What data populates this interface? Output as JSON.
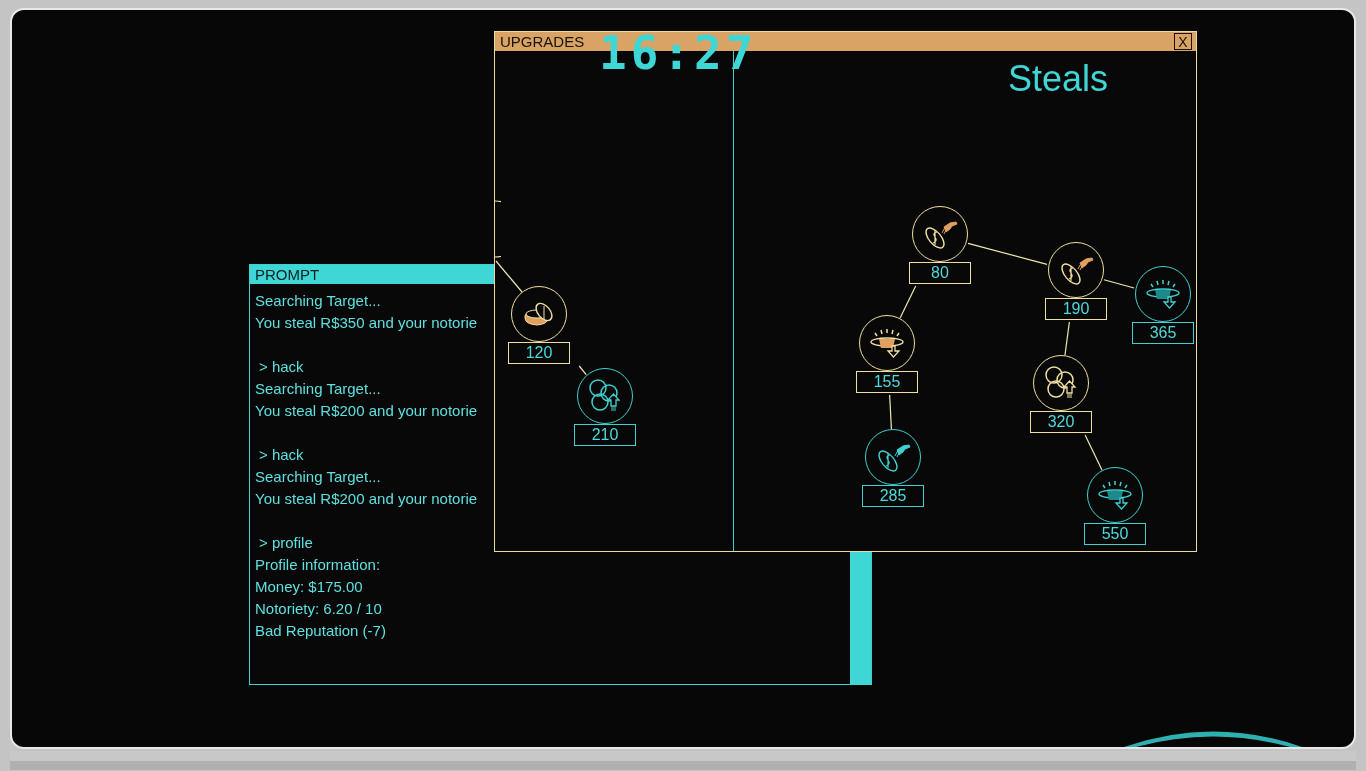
{
  "prompt_window": {
    "title": "PROMPT",
    "blocks": [
      {
        "lines": [
          "Searching Target...",
          "You steal R$350 and your notorie"
        ]
      },
      {
        "command": "> hack",
        "lines": [
          "Searching Target...",
          "You steal R$200 and your notorie"
        ]
      },
      {
        "command": "> hack",
        "lines": [
          "Searching Target...",
          "You steal R$200 and your notorie"
        ]
      },
      {
        "command": "> profile",
        "lines": [
          "Profile information:",
          "Money: $175.00",
          "Notoriety: 6.20 / 10",
          "Bad Reputation (-7)"
        ]
      }
    ]
  },
  "upgrades_window": {
    "title": "UPGRADES",
    "close_label": "X",
    "timer": "16:27",
    "left_tree": [
      {
        "cost": "120",
        "kind": "coins",
        "purchased": true,
        "children": [
          {
            "cost": "210",
            "kind": "bubbles",
            "purchased": false
          }
        ]
      }
    ],
    "right_panel": {
      "title": "Steals",
      "tree": [
        {
          "cost": "80",
          "kind": "steal",
          "purchased": true,
          "children": [
            {
              "cost": "155",
              "kind": "vault",
              "purchased": true,
              "children": [
                {
                  "cost": "285",
                  "kind": "steal",
                  "purchased": false
                }
              ]
            },
            {
              "cost": "190",
              "kind": "steal",
              "purchased": true,
              "children": [
                {
                  "cost": "320",
                  "kind": "bubbles",
                  "purchased": true,
                  "children": [
                    {
                      "cost": "550",
                      "kind": "vault",
                      "purchased": false
                    }
                  ]
                },
                {
                  "cost": "365",
                  "kind": "vault",
                  "purchased": false
                }
              ]
            }
          ]
        }
      ]
    }
  }
}
